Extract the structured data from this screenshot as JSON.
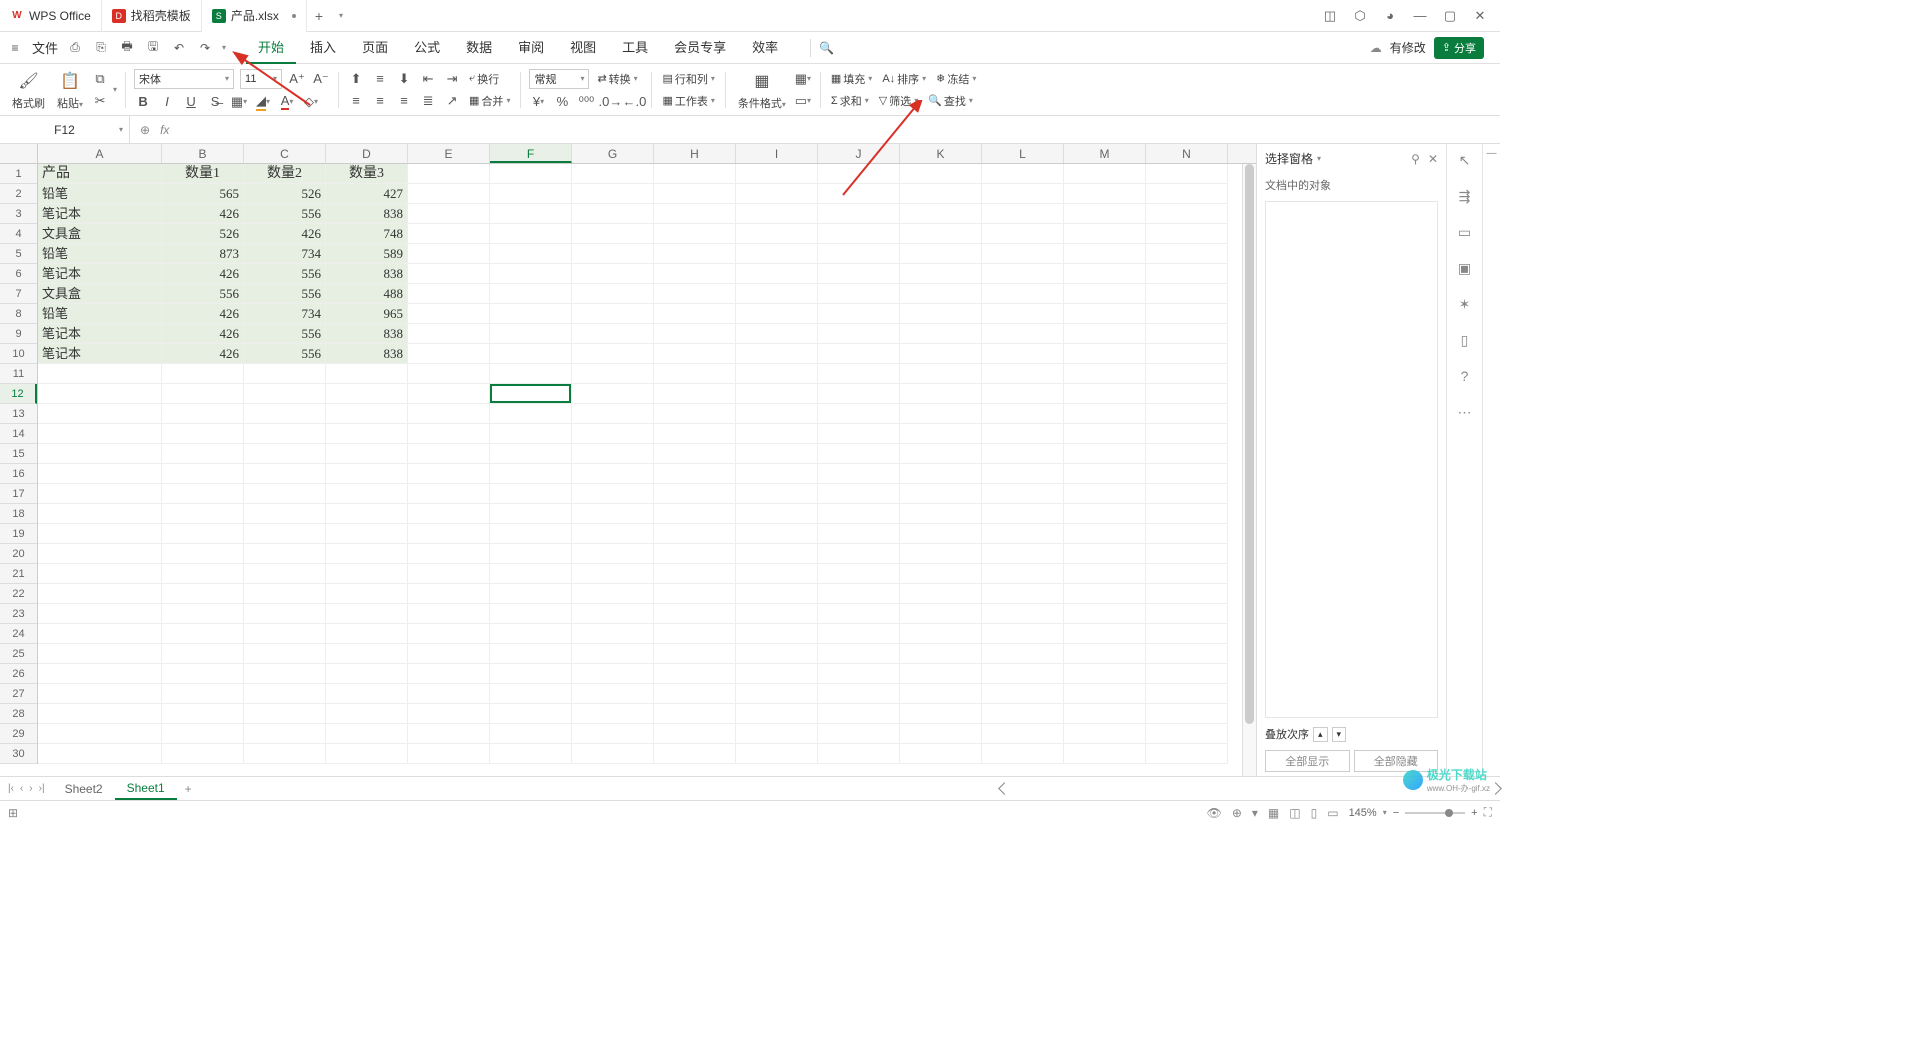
{
  "app": {
    "name": "WPS Office"
  },
  "tabs": [
    {
      "label": "WPS Office",
      "icon": "W"
    },
    {
      "label": "找稻壳模板",
      "icon": "D"
    },
    {
      "label": "产品.xlsx",
      "icon": "S",
      "modified": true
    }
  ],
  "menu": {
    "file": "文件",
    "items": [
      "开始",
      "插入",
      "页面",
      "公式",
      "数据",
      "审阅",
      "视图",
      "工具",
      "会员专享",
      "效率"
    ],
    "active": 0,
    "haschanges": "有修改",
    "share": "分享"
  },
  "ribbon": {
    "formatbrush": "格式刷",
    "paste": "粘贴",
    "font": "宋体",
    "fontsize": "11",
    "numfmt": "常规",
    "convert": "转换",
    "wrap": "换行",
    "merge": "合并",
    "rowcol": "行和列",
    "worksheet": "工作表",
    "condfmt": "条件格式",
    "fill": "填充",
    "sort": "排序",
    "freeze": "冻结",
    "sum": "求和",
    "filter": "筛选",
    "find": "查找"
  },
  "namebox": "F12",
  "cols": [
    "A",
    "B",
    "C",
    "D",
    "E",
    "F",
    "G",
    "H",
    "I",
    "J",
    "K",
    "L",
    "M",
    "N"
  ],
  "activeCol": 5,
  "activeRow": 12,
  "selectedCell": {
    "col": 5,
    "row": 12
  },
  "data": {
    "headers": [
      "产品",
      "数量1",
      "数量2",
      "数量3"
    ],
    "rows": [
      [
        "铅笔",
        565,
        526,
        427
      ],
      [
        "笔记本",
        426,
        556,
        838
      ],
      [
        "文具盒",
        526,
        426,
        748
      ],
      [
        "铅笔",
        873,
        734,
        589
      ],
      [
        "笔记本",
        426,
        556,
        838
      ],
      [
        "文具盒",
        556,
        556,
        488
      ],
      [
        "铅笔",
        426,
        734,
        965
      ],
      [
        "笔记本",
        426,
        556,
        838
      ],
      [
        "笔记本",
        426,
        556,
        838
      ]
    ]
  },
  "sidepanel": {
    "title": "选择窗格",
    "subtitle": "文档中的对象",
    "order": "叠放次序",
    "showall": "全部显示",
    "hideall": "全部隐藏"
  },
  "sheets": {
    "list": [
      "Sheet2",
      "Sheet1"
    ],
    "active": 1
  },
  "status": {
    "zoom": "145%"
  },
  "watermark": {
    "main": "极光下载站",
    "sub": "www.OH-办-gif.xz"
  }
}
